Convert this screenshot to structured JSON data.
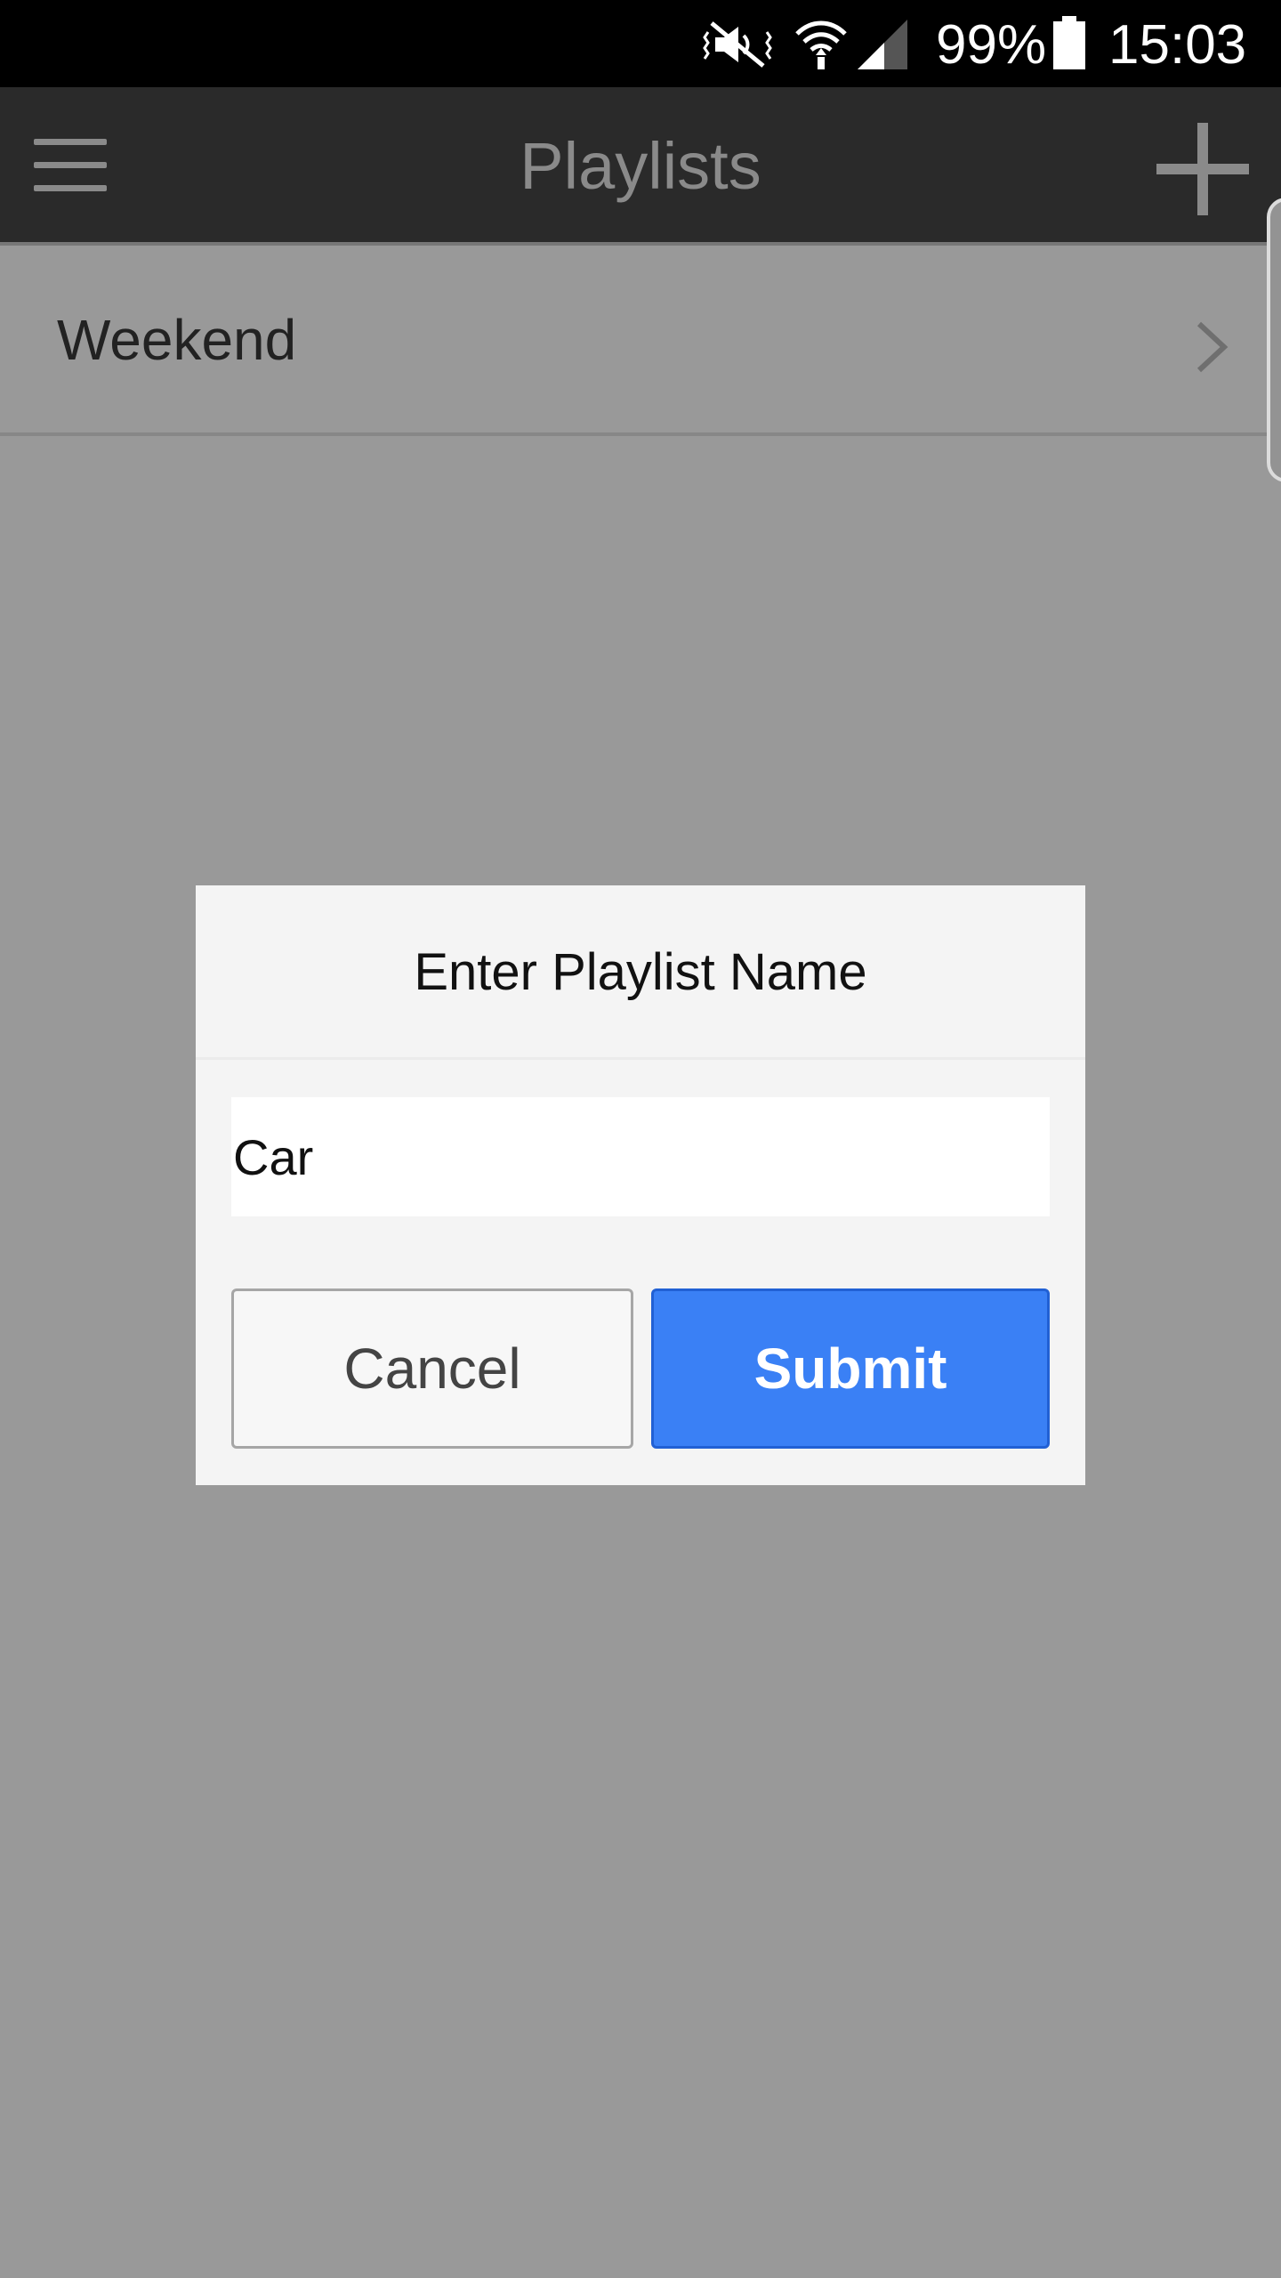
{
  "status_bar": {
    "battery_percent": "99%",
    "time": "15:03",
    "icons": [
      "mute-vibrate-icon",
      "wifi-icon",
      "cell-signal-icon",
      "battery-icon"
    ]
  },
  "app_bar": {
    "title": "Playlists",
    "menu_icon": "hamburger-menu-icon",
    "add_icon": "plus-icon"
  },
  "playlists": [
    {
      "name": "Weekend"
    }
  ],
  "dialog": {
    "title": "Enter Playlist Name",
    "input_value": "Car",
    "cancel_label": "Cancel",
    "submit_label": "Submit"
  },
  "colors": {
    "accent": "#3a80f5",
    "app_bar": "#2a2a2a",
    "overlay": "#999999"
  }
}
